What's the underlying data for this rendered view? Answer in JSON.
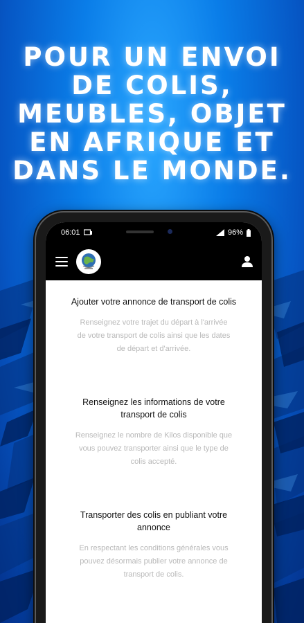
{
  "headline": {
    "lines": [
      "POUR UN ENVOI",
      "DE COLIS,",
      "MEUBLES, OBJET",
      "EN AFRIQUE ET",
      "DANS LE MONDE."
    ]
  },
  "status_bar": {
    "time": "06:01",
    "battery": "96%"
  },
  "app_bar": {
    "menu_icon": "hamburger-menu-icon",
    "logo_icon": "globe-logo",
    "account_icon": "person-icon"
  },
  "steps": [
    {
      "title": "Ajouter votre annonce de transport de colis",
      "description": "Renseignez votre trajet du départ à l'arrivée de votre transport de colis ainsi que les dates de départ et d'arrivée."
    },
    {
      "title": "Renseignez les informations de votre transport de colis",
      "description": "Renseignez le nombre de Kilos disponible que vous pouvez transporter ainsi que le type de colis accepté."
    },
    {
      "title": "Transporter des colis en publiant votre annonce",
      "description": "En respectant les conditions générales vous pouvez désormais publier votre annonce de transport de colis."
    }
  ],
  "colors": {
    "background": "#0a6fe0",
    "headline": "#ffffff",
    "step_title": "#111111",
    "step_desc": "#b8b8b8"
  }
}
